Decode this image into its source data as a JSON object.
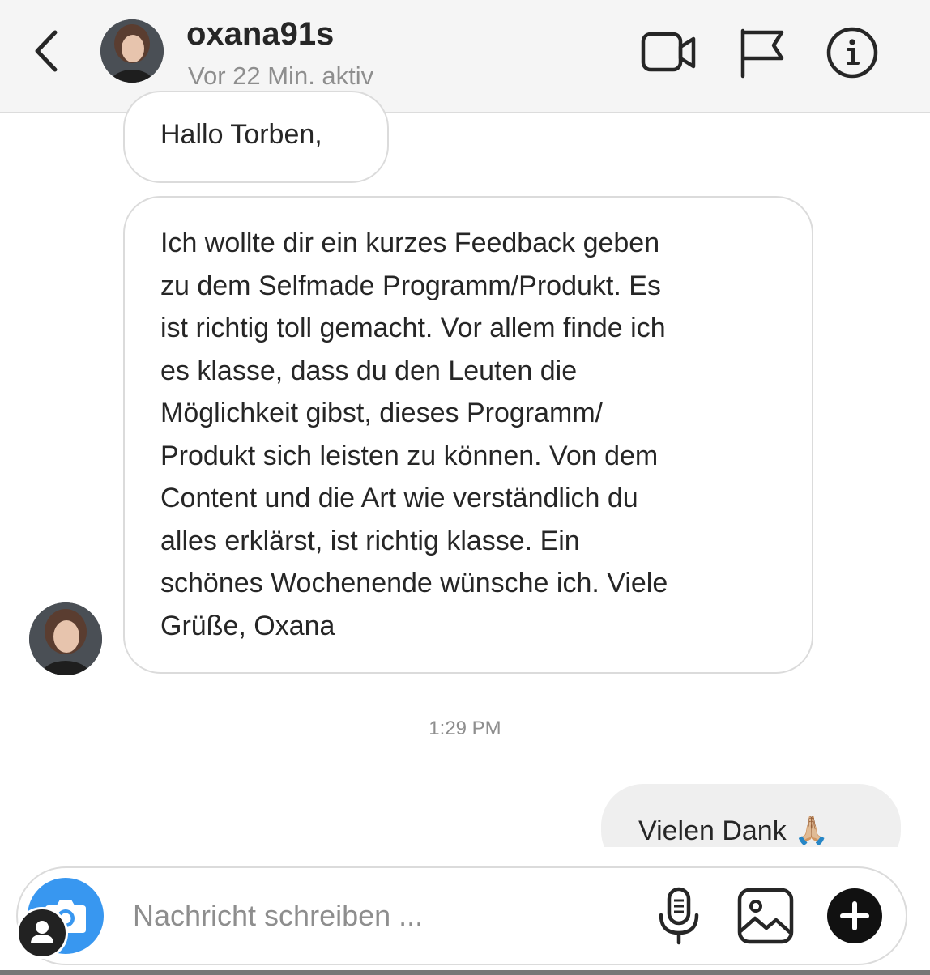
{
  "header": {
    "username": "oxana91s",
    "status": "Vor 22 Min. aktiv",
    "icons": [
      "chevron-left-icon",
      "video-call-icon",
      "flag-icon",
      "info-icon"
    ]
  },
  "messages": {
    "received": [
      "Hallo Torben,",
      "Ich wollte dir ein kurzes Feedback geben\nzu dem Selfmade Programm/Produkt. Es\nist richtig toll gemacht. Vor allem finde ich\nes klasse, dass du den Leuten die\nMöglichkeit gibst, dieses Programm/\nProdukt sich leisten zu können. Von dem\nContent und die Art wie verständlich du\nalles erklärst, ist richtig klasse. Ein\nschönes Wochenende wünsche ich. Viele\nGrüße, Oxana"
    ],
    "timestamp": "1:29 PM",
    "sent": {
      "text": "Vielen Dank",
      "emoji": "🙏🏼"
    }
  },
  "composer": {
    "placeholder": "Nachricht schreiben ...",
    "icons": [
      "camera-icon",
      "microphone-icon",
      "gallery-icon",
      "plus-icon"
    ]
  },
  "colors": {
    "header_bg": "#f5f5f5",
    "camera_blue": "#3897f0",
    "sent_bubble": "#efefef",
    "text": "#262626",
    "muted": "#8e8e8e"
  }
}
